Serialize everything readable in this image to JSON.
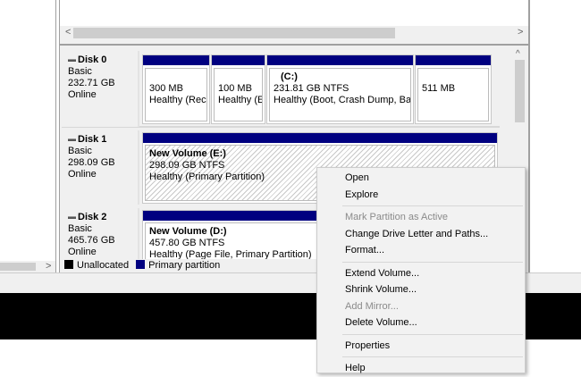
{
  "disks": [
    {
      "name": "Disk 0",
      "type": "Basic",
      "size": "232.71 GB",
      "status": "Online",
      "partitions": [
        {
          "title": "",
          "size": "300 MB",
          "status": "Healthy (Recc"
        },
        {
          "title": "",
          "size": "100 MB",
          "status": "Healthy (E"
        },
        {
          "title": "(C:)",
          "size": "231.81 GB NTFS",
          "status": "Healthy (Boot, Crash Dump, Basi"
        },
        {
          "title": "",
          "size": "511 MB",
          "status": ""
        }
      ]
    },
    {
      "name": "Disk 1",
      "type": "Basic",
      "size": "298.09 GB",
      "status": "Online",
      "partitions": [
        {
          "title": "New Volume  (E:)",
          "size": "298.09 GB NTFS",
          "status": "Healthy (Primary Partition)"
        }
      ]
    },
    {
      "name": "Disk 2",
      "type": "Basic",
      "size": "465.76 GB",
      "status": "Online",
      "partitions": [
        {
          "title": "New Volume  (D:)",
          "size": "457.80 GB NTFS",
          "status": "Healthy (Page File, Primary Partition)"
        }
      ]
    }
  ],
  "legend": {
    "unallocated": "Unallocated",
    "primary": "Primary partition"
  },
  "colors": {
    "primary": "#000080",
    "unallocated": "#000000"
  },
  "scroll": {
    "left": "<",
    "right": ">",
    "up": "^"
  },
  "menu": {
    "items": [
      {
        "label": "Open",
        "enabled": true
      },
      {
        "label": "Explore",
        "enabled": true
      },
      {
        "label": "Mark Partition as Active",
        "enabled": false
      },
      {
        "label": "Change Drive Letter and Paths...",
        "enabled": true
      },
      {
        "label": "Format...",
        "enabled": true
      },
      {
        "label": "Extend Volume...",
        "enabled": true
      },
      {
        "label": "Shrink Volume...",
        "enabled": true
      },
      {
        "label": "Add Mirror...",
        "enabled": false
      },
      {
        "label": "Delete Volume...",
        "enabled": true
      },
      {
        "label": "Properties",
        "enabled": true
      },
      {
        "label": "Help",
        "enabled": true
      }
    ]
  }
}
